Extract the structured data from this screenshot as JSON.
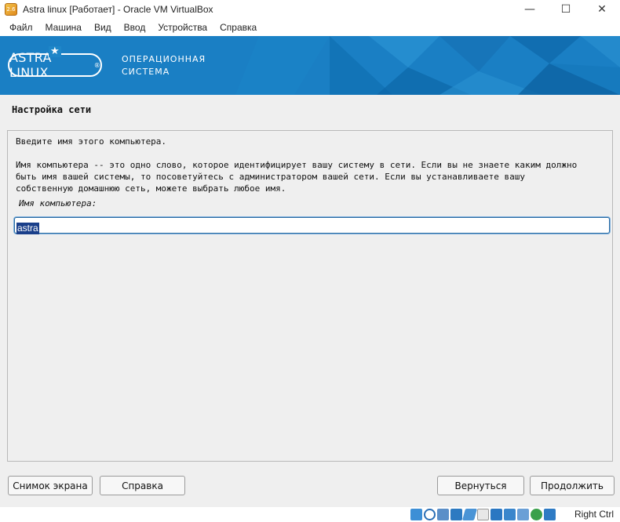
{
  "window": {
    "title": "Astra linux [Работает] - Oracle VM VirtualBox",
    "icon_text": "2.6",
    "controls": {
      "minimize": "—",
      "maximize": "☐",
      "close": "✕"
    }
  },
  "menu": [
    "Файл",
    "Машина",
    "Вид",
    "Ввод",
    "Устройства",
    "Справка"
  ],
  "banner": {
    "logo": "ASTRA LINUX",
    "logo_mark": "®",
    "star": "★",
    "subtitle_line1": "ОПЕРАЦИОННАЯ",
    "subtitle_line2": "СИСТЕМА",
    "color": "#1e86c8"
  },
  "installer": {
    "section_title": "Настройка сети",
    "prompt": "Введите имя этого компьютера.",
    "description": [
      "Имя компьютера -- это одно слово, которое идентифицирует вашу систему в сети. Если вы не знаете каким должно",
      "быть имя вашей системы, то посоветуйтесь с администратором вашей сети. Если вы устанавливаете вашу",
      "собственную домашнюю сеть, можете выбрать любое имя."
    ],
    "hostname_label": "Имя компьютера:",
    "hostname_value": "astra",
    "buttons": {
      "screenshot": "Снимок экрана",
      "help": "Справка",
      "back": "Вернуться",
      "continue": "Продолжить"
    }
  },
  "statusbar": {
    "icons": [
      "hard-disk-icon",
      "optical-drive-icon",
      "audio-icon",
      "network-icon",
      "usb-icon",
      "shared-folders-icon",
      "display-icon",
      "recording-icon",
      "vrde-icon",
      "cpu-icon",
      "mouse-integration-icon",
      "keyboard-icon"
    ],
    "host_key": "Right Ctrl"
  }
}
